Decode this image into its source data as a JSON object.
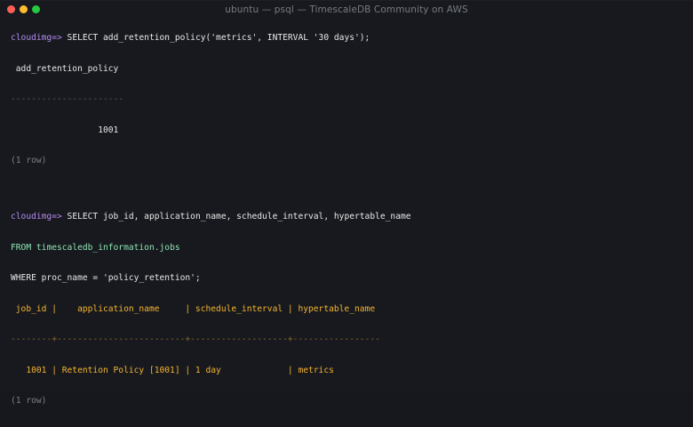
{
  "window": {
    "title": "ubuntu — psql — TimescaleDB Community on AWS",
    "colors": {
      "close": "#fe5f57",
      "minimize": "#febc2e",
      "zoom": "#28c840"
    }
  },
  "terminal": {
    "prompt": "cloudimg=>",
    "cmd1": " SELECT add_retention_policy('metrics', INTERVAL '30 days');",
    "result1_header": " add_retention_policy",
    "result1_sep": "----------------------",
    "result1_value": "                 1001",
    "result1_rows": "(1 row)",
    "cmd2_line1": " SELECT job_id, application_name, schedule_interval, hypertable_name",
    "cmd2_from_kw": "FROM ",
    "cmd2_from_table": "timescaledb_information.jobs",
    "cmd2_line3": "WHERE proc_name = 'policy_retention';",
    "result2_header": " job_id |    application_name     | schedule_interval | hypertable_name",
    "result2_sep": "--------+-------------------------+-------------------+-----------------",
    "result2_row": "   1001 | Retention Policy [1001] | 1 day             | metrics",
    "result2_rows": "(1 row)"
  }
}
